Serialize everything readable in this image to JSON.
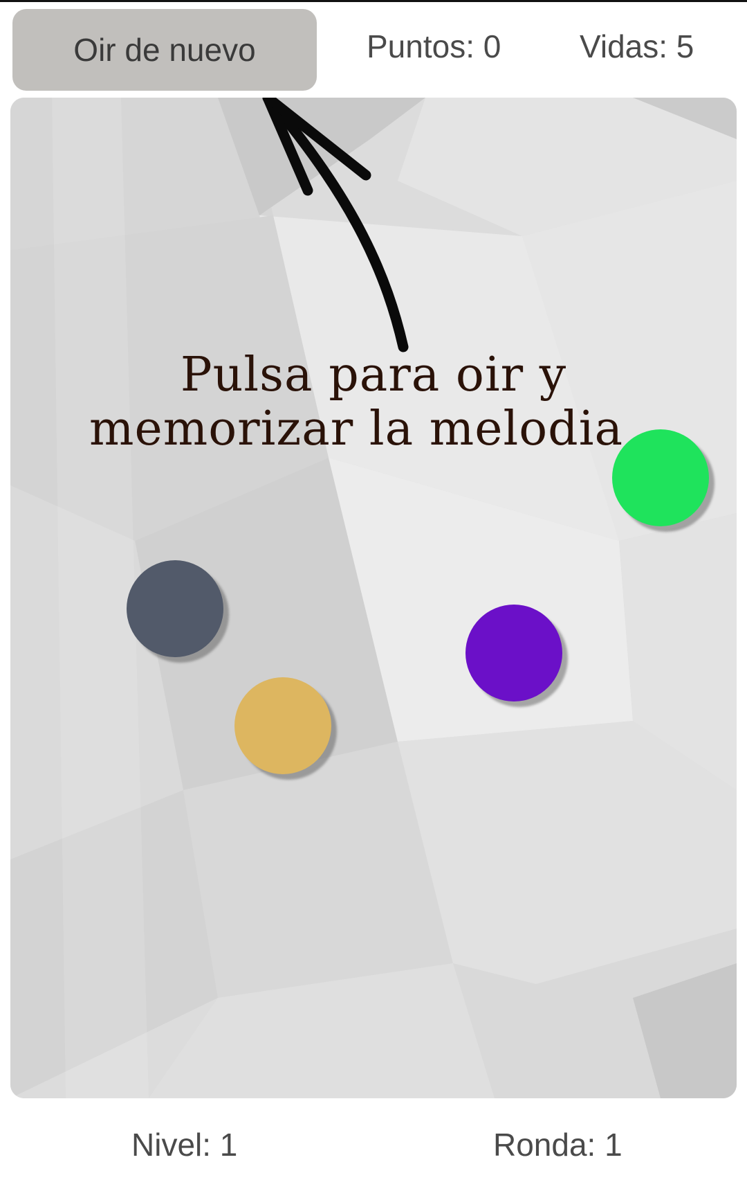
{
  "header": {
    "replay_label": "Oir de nuevo",
    "points_text": "Puntos: 0",
    "lives_text": "Vidas: 5"
  },
  "board": {
    "hint_line1": "Pulsa para oir y",
    "hint_line2": "memorizar la melodia",
    "arrow_icon": "hand-drawn-arrow-icon",
    "balls": [
      {
        "name": "green",
        "color": "#1fe35c"
      },
      {
        "name": "slate",
        "color": "#525a6a"
      },
      {
        "name": "purple",
        "color": "#6b10c8"
      },
      {
        "name": "yellow",
        "color": "#ddb660"
      }
    ]
  },
  "footer": {
    "level_text": "Nivel: 1",
    "round_text": "Ronda: 1"
  }
}
